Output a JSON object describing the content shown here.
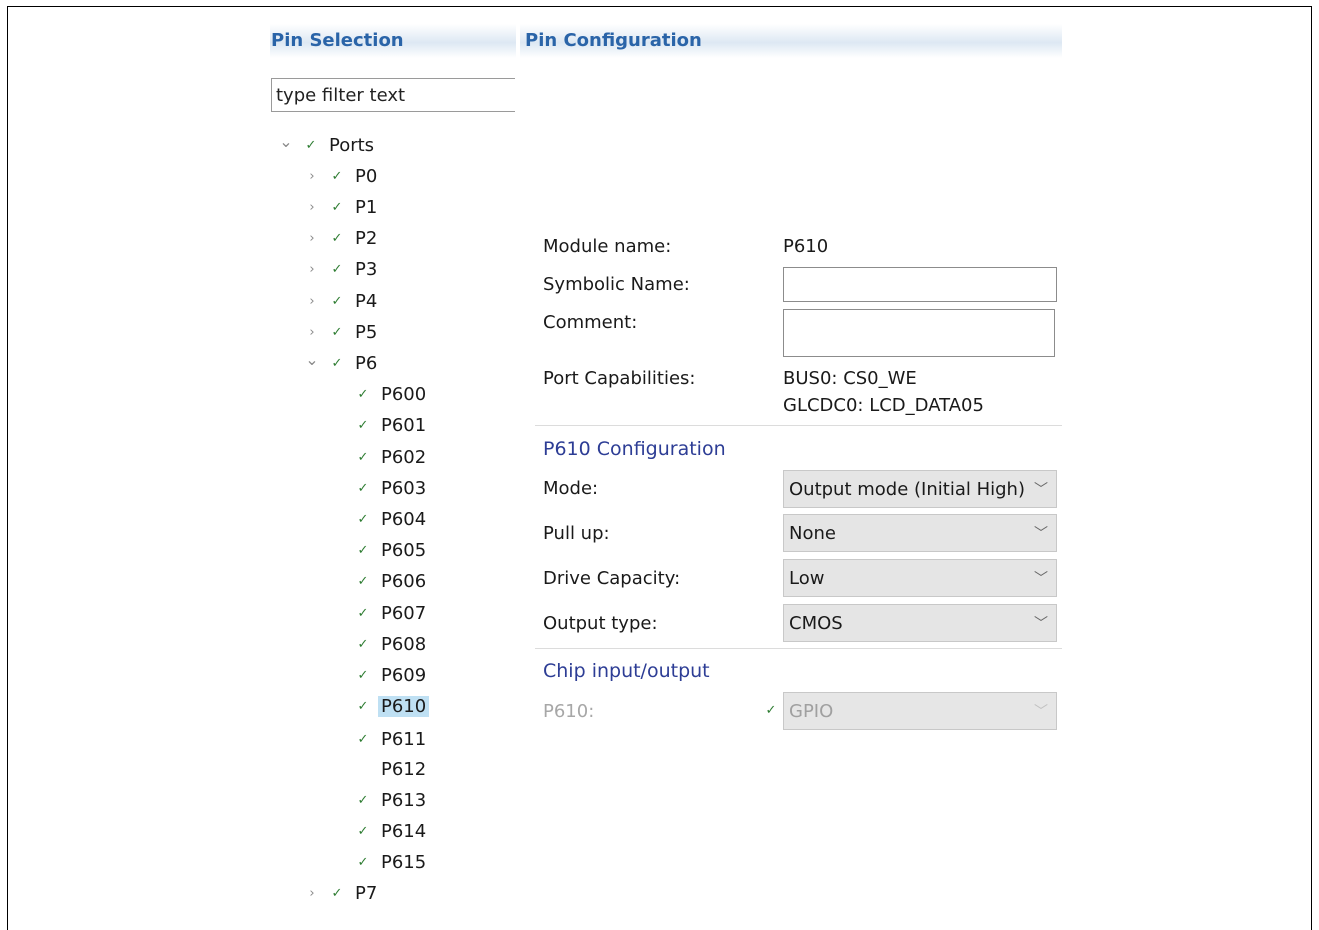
{
  "pin_selection": {
    "title": "Pin Selection",
    "filter_placeholder": "type filter text",
    "tree": [
      {
        "label": "Ports",
        "expanded": true,
        "checked": true,
        "level": 0
      },
      {
        "label": "P0",
        "expanded": false,
        "checked": true,
        "level": 1
      },
      {
        "label": "P1",
        "expanded": false,
        "checked": true,
        "level": 1
      },
      {
        "label": "P2",
        "expanded": false,
        "checked": true,
        "level": 1
      },
      {
        "label": "P3",
        "expanded": false,
        "checked": true,
        "level": 1
      },
      {
        "label": "P4",
        "expanded": false,
        "checked": true,
        "level": 1
      },
      {
        "label": "P5",
        "expanded": false,
        "checked": true,
        "level": 1
      },
      {
        "label": "P6",
        "expanded": true,
        "checked": true,
        "level": 1
      },
      {
        "label": "P600",
        "checked": true,
        "level": 2
      },
      {
        "label": "P601",
        "checked": true,
        "level": 2
      },
      {
        "label": "P602",
        "checked": true,
        "level": 2
      },
      {
        "label": "P603",
        "checked": true,
        "level": 2
      },
      {
        "label": "P604",
        "checked": true,
        "level": 2
      },
      {
        "label": "P605",
        "checked": true,
        "level": 2
      },
      {
        "label": "P606",
        "checked": true,
        "level": 2
      },
      {
        "label": "P607",
        "checked": true,
        "level": 2
      },
      {
        "label": "P608",
        "checked": true,
        "level": 2
      },
      {
        "label": "P609",
        "checked": true,
        "level": 2
      },
      {
        "label": "P610",
        "checked": true,
        "level": 2,
        "selected": true
      },
      {
        "label": "P611",
        "checked": true,
        "level": 2
      },
      {
        "label": "P612",
        "checked": false,
        "level": 2
      },
      {
        "label": "P613",
        "checked": true,
        "level": 2
      },
      {
        "label": "P614",
        "checked": true,
        "level": 2
      },
      {
        "label": "P615",
        "checked": true,
        "level": 2
      },
      {
        "label": "P7",
        "expanded": false,
        "checked": true,
        "level": 1
      }
    ]
  },
  "pin_config": {
    "title": "Pin Configuration",
    "module_name_label": "Module name:",
    "module_name_value": "P610",
    "symbolic_name_label": "Symbolic Name:",
    "symbolic_name_value": "",
    "comment_label": "Comment:",
    "comment_value": "",
    "port_capabilities_label": "Port Capabilities:",
    "port_capabilities": [
      "BUS0: CS0_WE",
      "GLCDC0: LCD_DATA05"
    ],
    "section_config": "P610 Configuration",
    "mode_label": "Mode:",
    "mode_value": "Output mode (Initial High)",
    "pullup_label": "Pull up:",
    "pullup_value": "None",
    "drive_label": "Drive Capacity:",
    "drive_value": "Low",
    "output_type_label": "Output type:",
    "output_type_value": "CMOS",
    "section_chip": "Chip input/output",
    "chip_pin_label": "P610:",
    "chip_pin_value": "GPIO",
    "chip_pin_checked": true
  },
  "icons": {
    "expanded": "chevron-down-icon",
    "collapsed": "chevron-right-icon",
    "check": "check-icon",
    "dropdown": "chevron-down-icon"
  }
}
